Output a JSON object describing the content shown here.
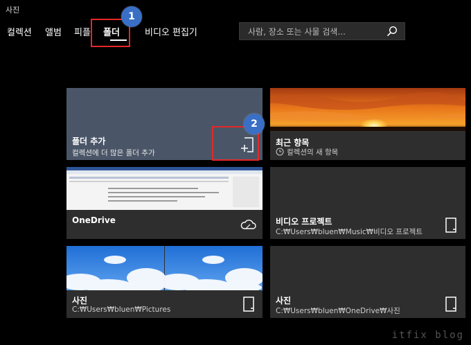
{
  "app": {
    "title": "사진"
  },
  "nav": {
    "items": [
      "컬렉션",
      "앨범",
      "피플",
      "폴더",
      "비디오 편집기"
    ],
    "active_index": 3
  },
  "search": {
    "placeholder": "사람, 장소 또는 사물 검색..."
  },
  "callouts": [
    "1",
    "2"
  ],
  "tiles": {
    "add_folder": {
      "title": "폴더 추가",
      "subtitle": "컬렉션에 더 많은 폴더 추가"
    },
    "recent": {
      "title": "최근 항목",
      "subtitle": "컬렉션의 새 항목"
    },
    "onedrive": {
      "title": "OneDrive"
    },
    "video_projects": {
      "title": "비디오 프로젝트",
      "path": "C:₩Users₩bluen₩Music₩비디오 프로젝트"
    },
    "pictures": {
      "title": "사진",
      "path": "C:₩Users₩bluen₩Pictures"
    },
    "onedrive_pictures": {
      "title": "사진",
      "path": "C:₩Users₩bluen₩OneDrive₩사진"
    }
  },
  "watermark": "itfix blog",
  "colors": {
    "callout_border": "#e52727",
    "badge": "#3a6fc6",
    "tile_bg": "#2e2e2e",
    "add_folder_bg": "#4a5668"
  }
}
